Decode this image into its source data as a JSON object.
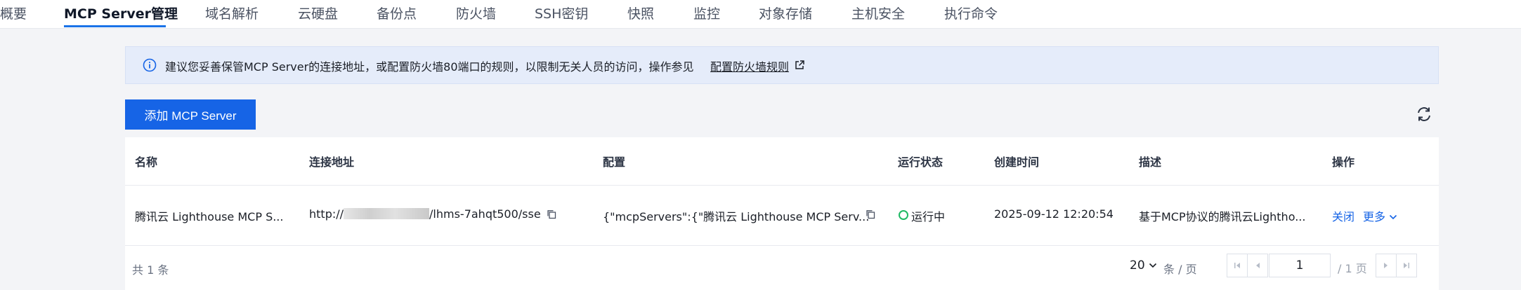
{
  "tabs": [
    {
      "label": "概要"
    },
    {
      "label": "MCP Server管理"
    },
    {
      "label": "域名解析"
    },
    {
      "label": "云硬盘"
    },
    {
      "label": "备份点"
    },
    {
      "label": "防火墙"
    },
    {
      "label": "SSH密钥"
    },
    {
      "label": "快照"
    },
    {
      "label": "监控"
    },
    {
      "label": "对象存储"
    },
    {
      "label": "主机安全"
    },
    {
      "label": "执行命令"
    }
  ],
  "notice": {
    "text": "建议您妥善保管MCP Server的连接地址，或配置防火墙80端口的规则，以限制无关人员的访问，操作参见",
    "link": "配置防火墙规则"
  },
  "toolbar": {
    "add_label": "添加 MCP Server"
  },
  "table": {
    "headers": {
      "name": "名称",
      "address": "连接地址",
      "config": "配置",
      "status": "运行状态",
      "created": "创建时间",
      "desc": "描述",
      "ops": "操作"
    },
    "rows": [
      {
        "name": "腾讯云 Lighthouse MCP S...",
        "address_prefix": "http://",
        "address_suffix": "/lhms-7ahqt500/sse",
        "config": "{\"mcpServers\":{\"腾讯云 Lighthouse MCP Serv...",
        "status": "运行中",
        "created": "2025-09-12 12:20:54",
        "desc": "基于MCP协议的腾讯云Lightho...",
        "op_close": "关闭",
        "op_more": "更多"
      }
    ]
  },
  "pager": {
    "total": "共 1 条",
    "page_size": "20",
    "page_size_unit": "条 / 页",
    "current_page": "1",
    "total_pages": "/ 1 页"
  },
  "colors": {
    "accent": "#1664e6",
    "status_running": "#1fb964",
    "notice_bg": "#e5ecfa"
  }
}
